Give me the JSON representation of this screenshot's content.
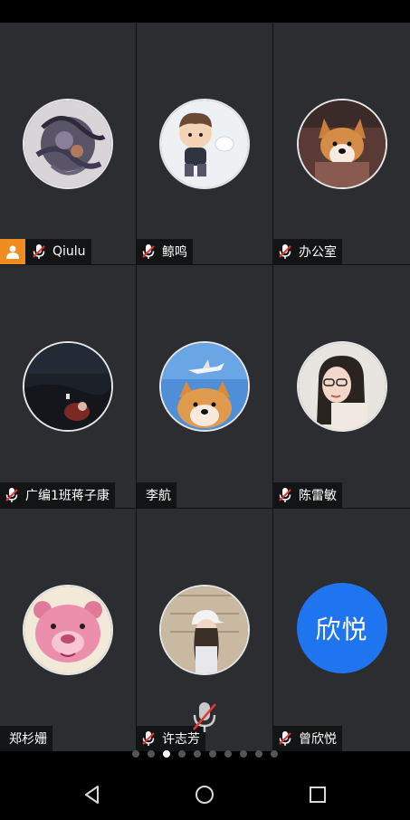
{
  "participants": [
    {
      "name": "Qiulu",
      "muted": true,
      "host": true,
      "avatar": "abstract-art-avatar"
    },
    {
      "name": "鲸鸣",
      "muted": true,
      "host": false,
      "avatar": "cartoon-boy-avatar"
    },
    {
      "name": "办公室",
      "muted": true,
      "host": false,
      "avatar": "corgi-dog-avatar"
    },
    {
      "name": "广编1班蒋子康",
      "muted": true,
      "host": false,
      "avatar": "dark-scene-avatar"
    },
    {
      "name": "李航",
      "muted": false,
      "host": false,
      "avatar": "shiba-airplane-avatar"
    },
    {
      "name": "陈雷敏",
      "muted": true,
      "host": false,
      "avatar": "girl-portrait-avatar"
    },
    {
      "name": "郑杉姗",
      "muted": false,
      "host": false,
      "avatar": "pink-bear-avatar"
    },
    {
      "name": "许志芳",
      "muted": true,
      "host": false,
      "avatar": "girl-cap-avatar"
    },
    {
      "name": "曾欣悦",
      "muted": true,
      "host": false,
      "avatar_text": "欣悦",
      "avatar_color": "#1f75f0"
    }
  ],
  "pagination": {
    "total_pages": 10,
    "current_page": 3
  },
  "colors": {
    "host_badge": "#f08c1e",
    "muted_mic_slash": "#e53935",
    "text_avatar_bg": "#1f75f0"
  },
  "navbar": {
    "back_icon": "triangle-back-icon",
    "home_icon": "circle-home-icon",
    "recents_icon": "square-recents-icon"
  }
}
